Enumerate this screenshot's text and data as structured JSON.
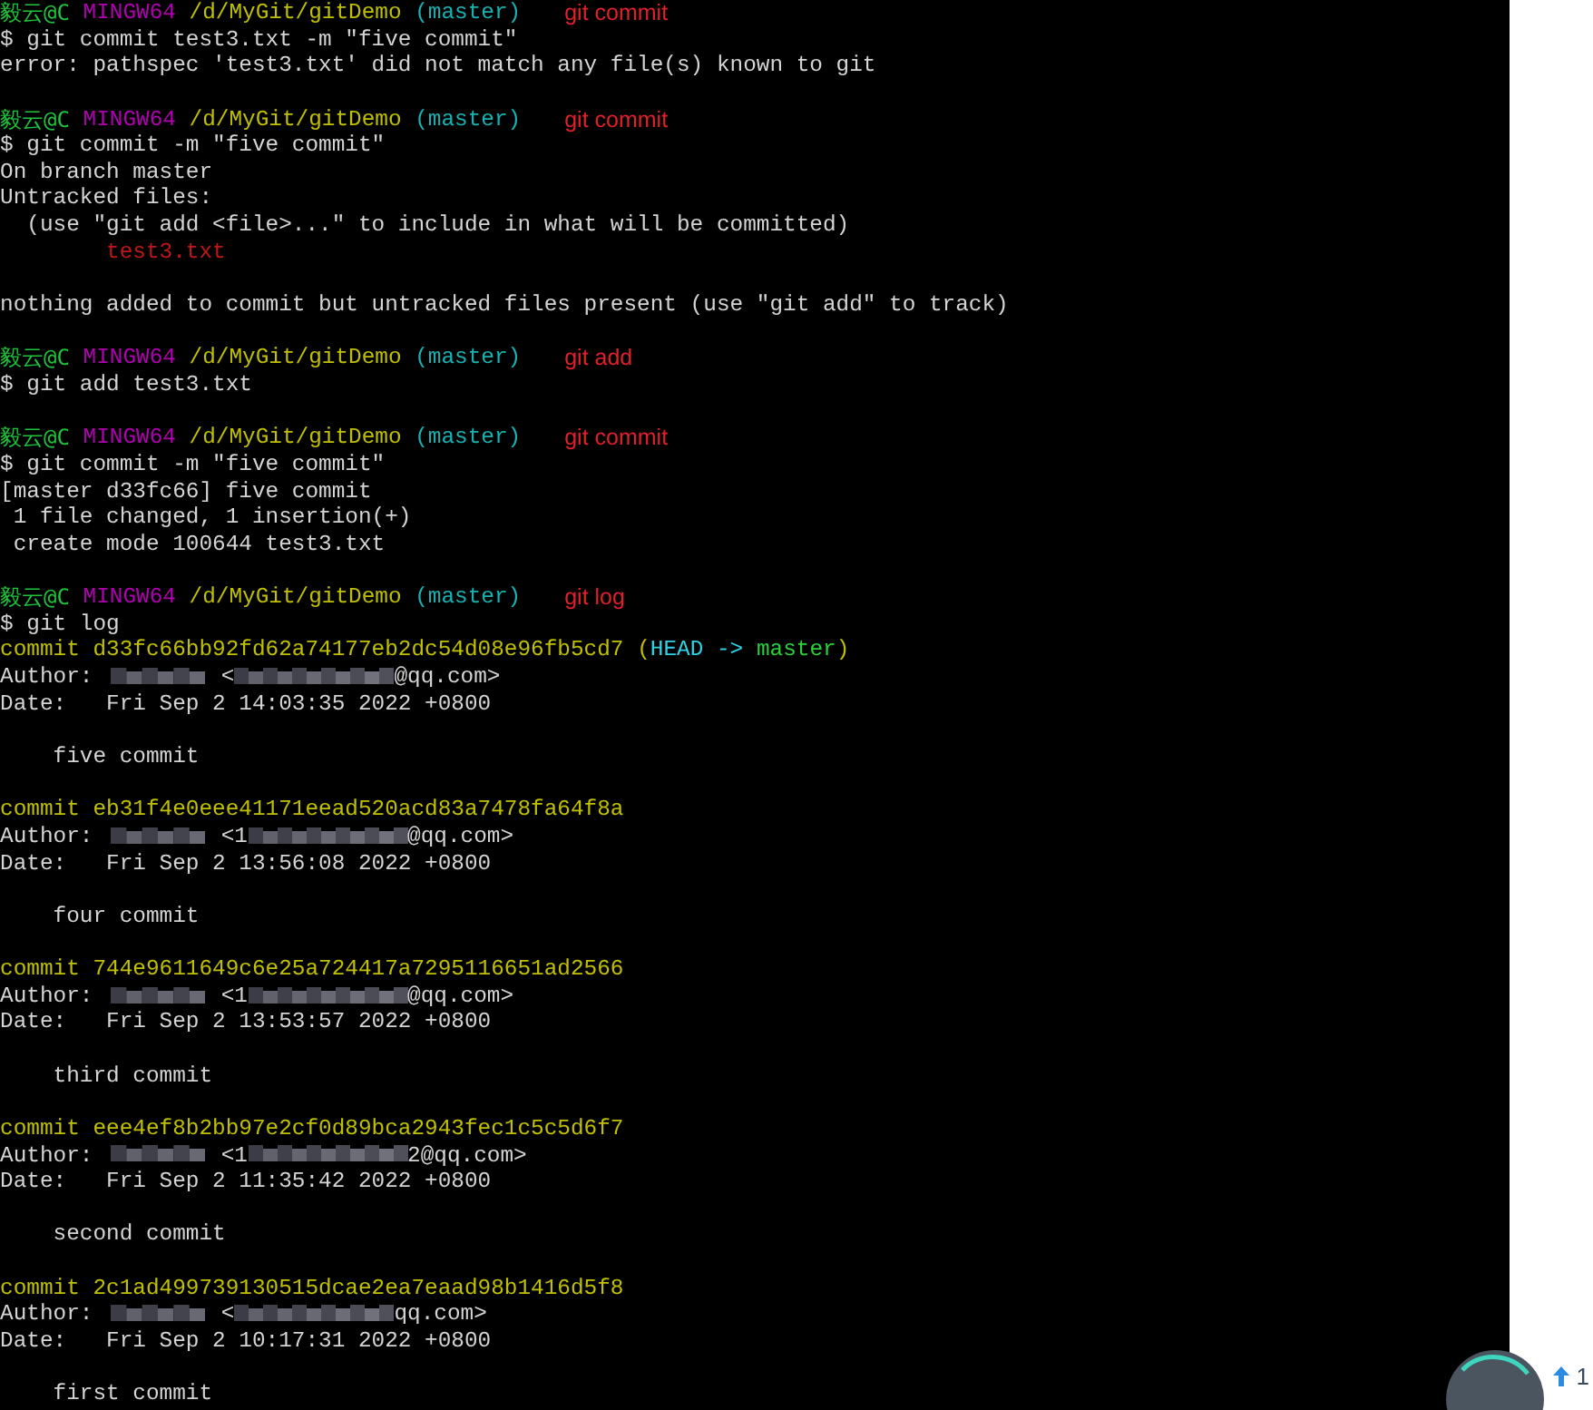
{
  "terminal": {
    "lines": [
      {
        "kind": "prompt",
        "user": "毅云@C",
        "system": "MINGW64",
        "path": "/d/MyGit/gitDemo",
        "branch": "(master)",
        "note": "git commit"
      },
      {
        "kind": "command",
        "text": "$ git commit test3.txt -m \"five commit\""
      },
      {
        "kind": "output",
        "text": "error: pathspec 'test3.txt' did not match any file(s) known to git"
      },
      {
        "kind": "blank"
      },
      {
        "kind": "prompt",
        "user": "毅云@C",
        "system": "MINGW64",
        "path": "/d/MyGit/gitDemo",
        "branch": "(master)",
        "note": "git commit"
      },
      {
        "kind": "command",
        "text": "$ git commit -m \"five commit\""
      },
      {
        "kind": "output",
        "text": "On branch master"
      },
      {
        "kind": "output",
        "text": "Untracked files:"
      },
      {
        "kind": "output",
        "text": "  (use \"git add <file>...\" to include in what will be committed)"
      },
      {
        "kind": "untracked",
        "text": "        test3.txt"
      },
      {
        "kind": "blank"
      },
      {
        "kind": "output",
        "text": "nothing added to commit but untracked files present (use \"git add\" to track)"
      },
      {
        "kind": "blank"
      },
      {
        "kind": "prompt",
        "user": "毅云@C",
        "system": "MINGW64",
        "path": "/d/MyGit/gitDemo",
        "branch": "(master)",
        "note": "git add"
      },
      {
        "kind": "command",
        "text": "$ git add test3.txt"
      },
      {
        "kind": "blank"
      },
      {
        "kind": "prompt",
        "user": "毅云@C",
        "system": "MINGW64",
        "path": "/d/MyGit/gitDemo",
        "branch": "(master)",
        "note": "git commit"
      },
      {
        "kind": "command",
        "text": "$ git commit -m \"five commit\""
      },
      {
        "kind": "output",
        "text": "[master d33fc66] five commit"
      },
      {
        "kind": "output",
        "text": " 1 file changed, 1 insertion(+)"
      },
      {
        "kind": "output",
        "text": " create mode 100644 test3.txt"
      },
      {
        "kind": "blank"
      },
      {
        "kind": "prompt",
        "user": "毅云@C",
        "system": "MINGW64",
        "path": "/d/MyGit/gitDemo",
        "branch": "(master)",
        "note": "git log"
      },
      {
        "kind": "command",
        "text": "$ git log"
      },
      {
        "kind": "commit",
        "text": "commit d33fc66bb92fd62a74177eb2dc54d08e96fb5cd7",
        "ref_open": "(",
        "head": "HEAD ->",
        "ref_branch": "master",
        "ref_close": ")"
      },
      {
        "kind": "author",
        "label": "Author:",
        "before": "<",
        "after": "@qq.com>"
      },
      {
        "kind": "output",
        "text": "Date:   Fri Sep 2 14:03:35 2022 +0800"
      },
      {
        "kind": "blank"
      },
      {
        "kind": "output",
        "text": "    five commit"
      },
      {
        "kind": "blank"
      },
      {
        "kind": "commit",
        "text": "commit eb31f4e0eee41171eead520acd83a7478fa64f8a"
      },
      {
        "kind": "author",
        "label": "Author:",
        "before": "<1",
        "after": "@qq.com>"
      },
      {
        "kind": "output",
        "text": "Date:   Fri Sep 2 13:56:08 2022 +0800"
      },
      {
        "kind": "blank"
      },
      {
        "kind": "output",
        "text": "    four commit"
      },
      {
        "kind": "blank"
      },
      {
        "kind": "commit",
        "text": "commit 744e9611649c6e25a724417a7295116651ad2566"
      },
      {
        "kind": "author",
        "label": "Author:",
        "before": "<1",
        "after": "@qq.com>"
      },
      {
        "kind": "output",
        "text": "Date:   Fri Sep 2 13:53:57 2022 +0800"
      },
      {
        "kind": "blank"
      },
      {
        "kind": "output",
        "text": "    third commit"
      },
      {
        "kind": "blank"
      },
      {
        "kind": "commit",
        "text": "commit eee4ef8b2bb97e2cf0d89bca2943fec1c5c5d6f7"
      },
      {
        "kind": "author",
        "label": "Author:",
        "before": "<1",
        "after": "2@qq.com>"
      },
      {
        "kind": "output",
        "text": "Date:   Fri Sep 2 11:35:42 2022 +0800"
      },
      {
        "kind": "blank"
      },
      {
        "kind": "output",
        "text": "    second commit"
      },
      {
        "kind": "blank"
      },
      {
        "kind": "commit",
        "text": "commit 2c1ad499739130515dcae2ea7eaad98b1416d5f8"
      },
      {
        "kind": "author",
        "label": "Author:",
        "before": "<",
        "after": "qq.com>"
      },
      {
        "kind": "output",
        "text": "Date:   Fri Sep 2 10:17:31 2022 +0800"
      },
      {
        "kind": "blank"
      },
      {
        "kind": "output",
        "text": "    first commit"
      }
    ]
  },
  "corner_widget": {
    "count": "1"
  }
}
